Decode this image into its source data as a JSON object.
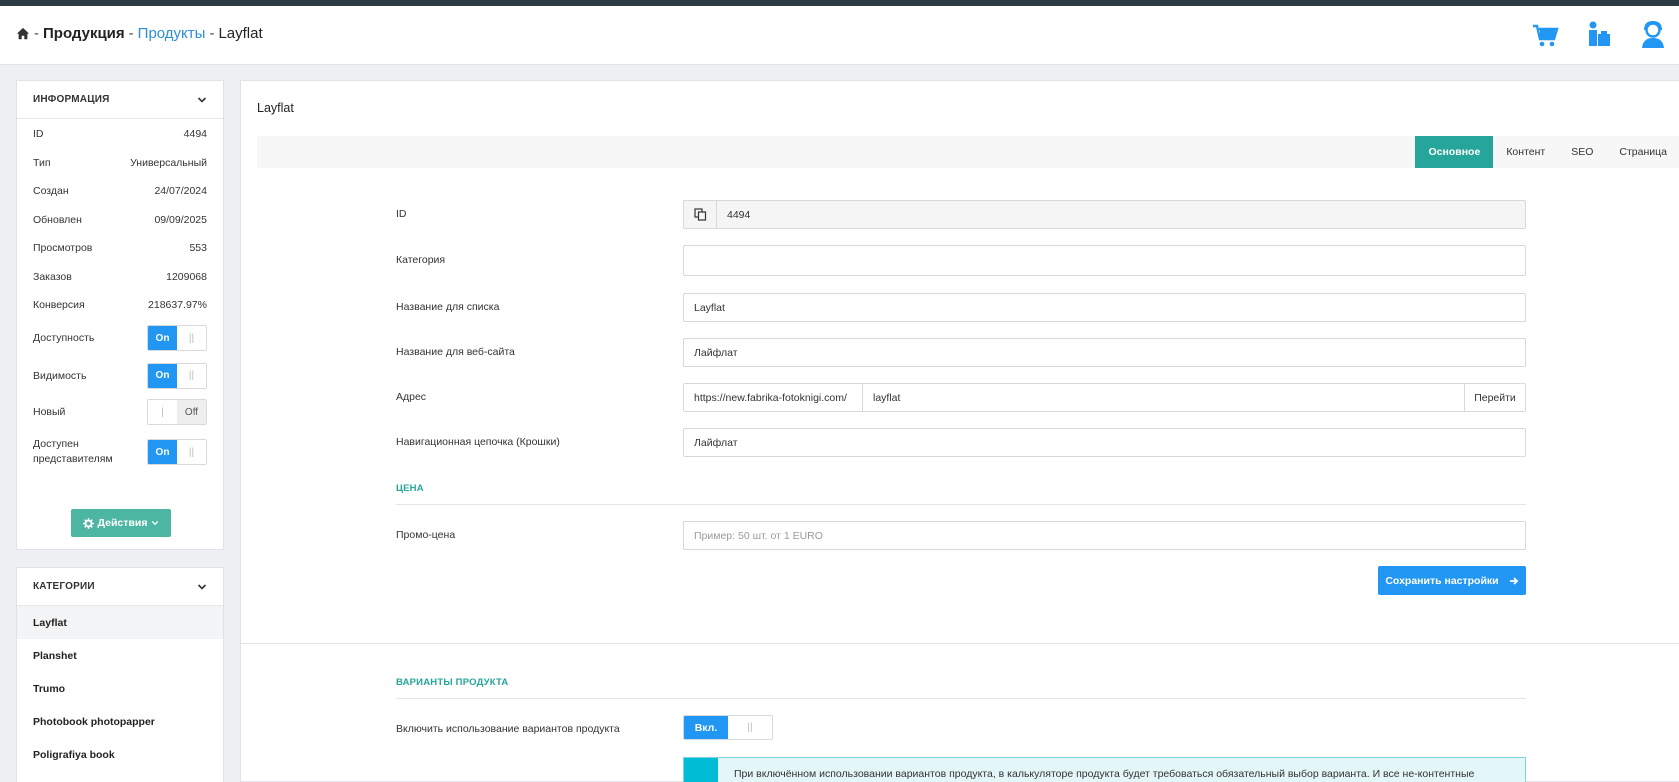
{
  "breadcrumb": {
    "home_icon": "home-icon",
    "sep1": "-",
    "products_root": "Продукция",
    "sep2": "-",
    "products": "Продукты",
    "sep3": "-",
    "current": "Layflat"
  },
  "header_icons": [
    "cart-icon",
    "delivery-icon",
    "support-icon"
  ],
  "info_panel": {
    "title": "ИНФОРМАЦИЯ",
    "rows": [
      {
        "label": "ID",
        "value": "4494"
      },
      {
        "label": "Тип",
        "value": "Универсальный"
      },
      {
        "label": "Создан",
        "value": "24/07/2024"
      },
      {
        "label": "Обновлен",
        "value": "09/09/2025"
      },
      {
        "label": "Просмотров",
        "value": "553"
      },
      {
        "label": "Заказов",
        "value": "1209068"
      },
      {
        "label": "Конверсия",
        "value": "218637.97%"
      }
    ],
    "toggles": [
      {
        "label": "Доступность",
        "state": "On"
      },
      {
        "label": "Видимость",
        "state": "On"
      },
      {
        "label": "Новый",
        "state": "Off"
      },
      {
        "label": "Доступен представителям",
        "state": "On"
      }
    ],
    "actions_label": "Действия"
  },
  "categories_panel": {
    "title": "КАТЕГОРИИ",
    "items": [
      "Layflat",
      "Planshet",
      "Trumo",
      "Photobook photopapper",
      "Poligrafiya book"
    ]
  },
  "main": {
    "title": "Layflat",
    "tabs": [
      "Основное",
      "Контент",
      "SEO",
      "Страница"
    ],
    "active_tab": "Основное",
    "fields": {
      "id_label": "ID",
      "id_value": "4494",
      "category_label": "Категория",
      "category_value": "",
      "list_name_label": "Название для списка",
      "list_name_value": "Layflat",
      "web_name_label": "Название для веб-сайта",
      "web_name_value": "Лайфлат",
      "address_label": "Адрес",
      "address_prefix": "https://new.fabrika-fotoknigi.com/",
      "address_slug": "layflat",
      "address_go": "Перейти",
      "breadcrumbs_label": "Навигационная цепочка (Крошки)",
      "breadcrumbs_value": "Лайфлат"
    },
    "price_section": "ЦЕНА",
    "promo_label": "Промо-цена",
    "promo_placeholder": "Пример: 50 шт. от 1 EURO",
    "save_label": "Сохранить настройки",
    "variants_section": "ВАРИАНТЫ ПРОДУКТА",
    "variants_toggle_label": "Включить использование вариантов продукта",
    "variants_toggle_on": "Вкл.",
    "variants_info": "При включённом использовании вариантов продукта, в калькуляторе продукта будет требоваться обязательный выбор варианта. И все не-контентные"
  },
  "colors": {
    "accent_teal": "#26a69a",
    "primary_blue": "#2196f3",
    "link_blue": "#2b8fd8",
    "topbar": "#2d3b45"
  }
}
